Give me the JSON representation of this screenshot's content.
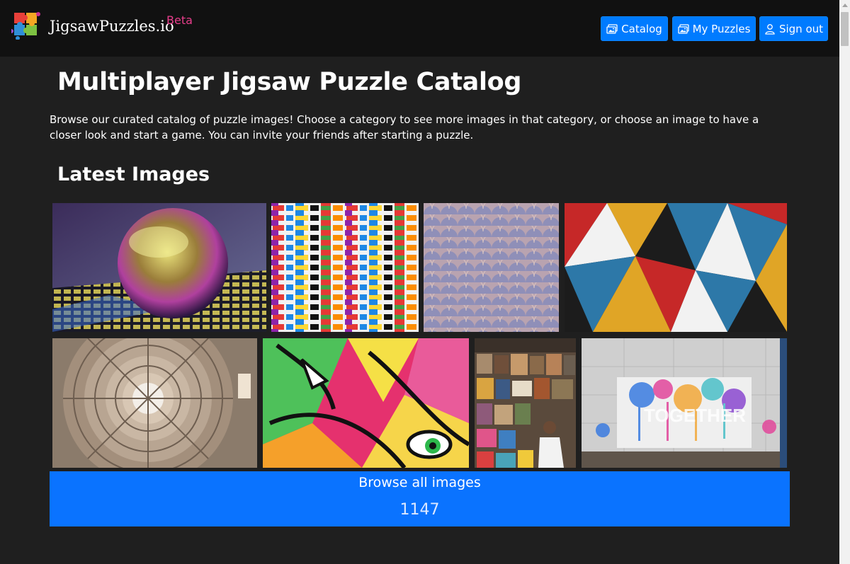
{
  "header": {
    "brand": "JigsawPuzzles.io",
    "badge": "Beta",
    "nav": {
      "catalog_label": "Catalog",
      "my_puzzles_label": "My Puzzles",
      "sign_out_label": "Sign out"
    }
  },
  "main": {
    "title": "Multiplayer Jigsaw Puzzle Catalog",
    "intro": "Browse our curated catalog of puzzle images! Choose a category to see more images in that category, or choose an image to have a closer look and start a game. You can invite your friends after starting a puzzle.",
    "latest_heading": "Latest Images",
    "images": [
      {
        "name": "crystal-ball-image"
      },
      {
        "name": "colorful-bricks-image"
      },
      {
        "name": "scale-pattern-image"
      },
      {
        "name": "triangle-mural-image"
      },
      {
        "name": "dome-ceiling-image"
      },
      {
        "name": "graffiti-eyes-image"
      },
      {
        "name": "market-bags-image"
      },
      {
        "name": "together-wall-image",
        "text": "TOGETHER"
      }
    ],
    "browse": {
      "label": "Browse all images",
      "count": "1147"
    }
  },
  "colors": {
    "background": "#1f1f1f",
    "navbar": "#111111",
    "accent": "#007bff",
    "badge": "#e83e8c"
  },
  "icons": [
    "puzzle-logo-icon",
    "images-icon",
    "person-icon"
  ]
}
